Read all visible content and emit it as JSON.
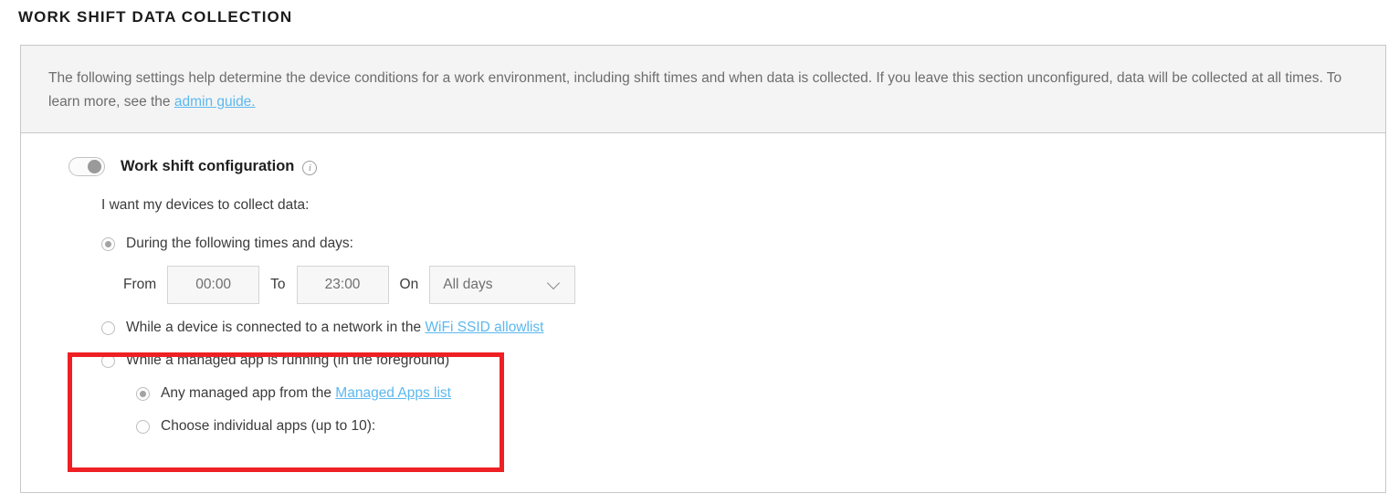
{
  "page": {
    "title": "WORK SHIFT DATA COLLECTION"
  },
  "banner": {
    "text_before_link": "The following settings help determine the device conditions for a work environment, including shift times and when data is collected. If you leave this section unconfigured, data will be collected at all times. To learn more, see the ",
    "link_label": "admin guide.",
    "link_color": "#5cb8ef"
  },
  "toggle": {
    "label": "Work shift configuration",
    "state": "off",
    "info_icon": "info-circle-icon",
    "info_glyph": "i"
  },
  "options": {
    "prompt": "I want my devices to collect data:",
    "items": [
      {
        "label": "During the following times and days:",
        "selected": true
      },
      {
        "label_before_link": "While a device is connected to a network in the ",
        "link_label": "WiFi SSID allowlist",
        "selected": false
      },
      {
        "label": "While a managed app is running (in the foreground)",
        "selected": false
      }
    ],
    "sub_items": [
      {
        "label_before_link": "Any managed app from the ",
        "link_label": "Managed Apps list",
        "selected": true
      },
      {
        "label": "Choose individual apps (up to 10):",
        "selected": false
      }
    ]
  },
  "schedule": {
    "from_word": "From",
    "from_value": "00:00",
    "to_word": "To",
    "to_value": "23:00",
    "on_word": "On",
    "days_value": "All days",
    "days_chevron": "chevron-down-icon"
  },
  "annotation": {
    "color": "#ee2024",
    "shape": "rectangle-highlight"
  }
}
